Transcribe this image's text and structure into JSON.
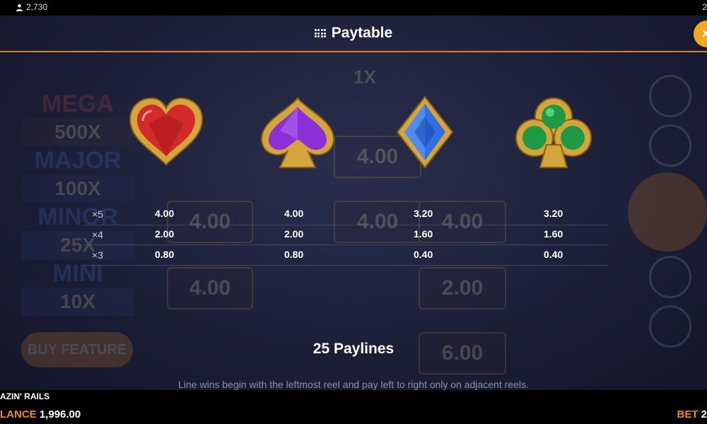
{
  "status": {
    "player_count": "2,730",
    "right_digit": "2"
  },
  "header": {
    "title": "Paytable",
    "close_label": "×"
  },
  "background": {
    "jackpots": [
      "MEGA",
      "500X",
      "MAJOR",
      "100X",
      "MINOR",
      "25X",
      "MINI",
      "10X"
    ],
    "reel_values": [
      "4.00",
      "4.00",
      "4.00",
      "4.00",
      "4.00",
      "2.00",
      "6.00"
    ],
    "top_multiplier": "1X",
    "buy_feature": "BUY FEATURE"
  },
  "paytable": {
    "multipliers": [
      "×5",
      "×4",
      "×3"
    ],
    "symbols": [
      {
        "icon": "heart-icon",
        "color": "#d42a2a",
        "payouts": [
          "4.00",
          "2.00",
          "0.80"
        ]
      },
      {
        "icon": "spade-icon",
        "color": "#8b2fd6",
        "payouts": [
          "4.00",
          "2.00",
          "0.80"
        ]
      },
      {
        "icon": "diamond-icon",
        "color": "#2f6fe0",
        "payouts": [
          "3.20",
          "1.60",
          "0.40"
        ]
      },
      {
        "icon": "club-icon",
        "color": "#1e9a45",
        "payouts": [
          "3.20",
          "1.60",
          "0.40"
        ]
      }
    ]
  },
  "paylines": "25 Paylines",
  "description": "Line wins begin with the leftmost reel and pay left to right only on adjacent reels.",
  "footer": {
    "game_name": "AZIN' RAILS",
    "balance_label": "LANCE",
    "balance_value": "1,996.00",
    "bet_label": "BET",
    "bet_value": "2"
  },
  "colors": {
    "accent": "#e07a1f",
    "close": "#f4a91c",
    "gold": "#d4a53a"
  }
}
